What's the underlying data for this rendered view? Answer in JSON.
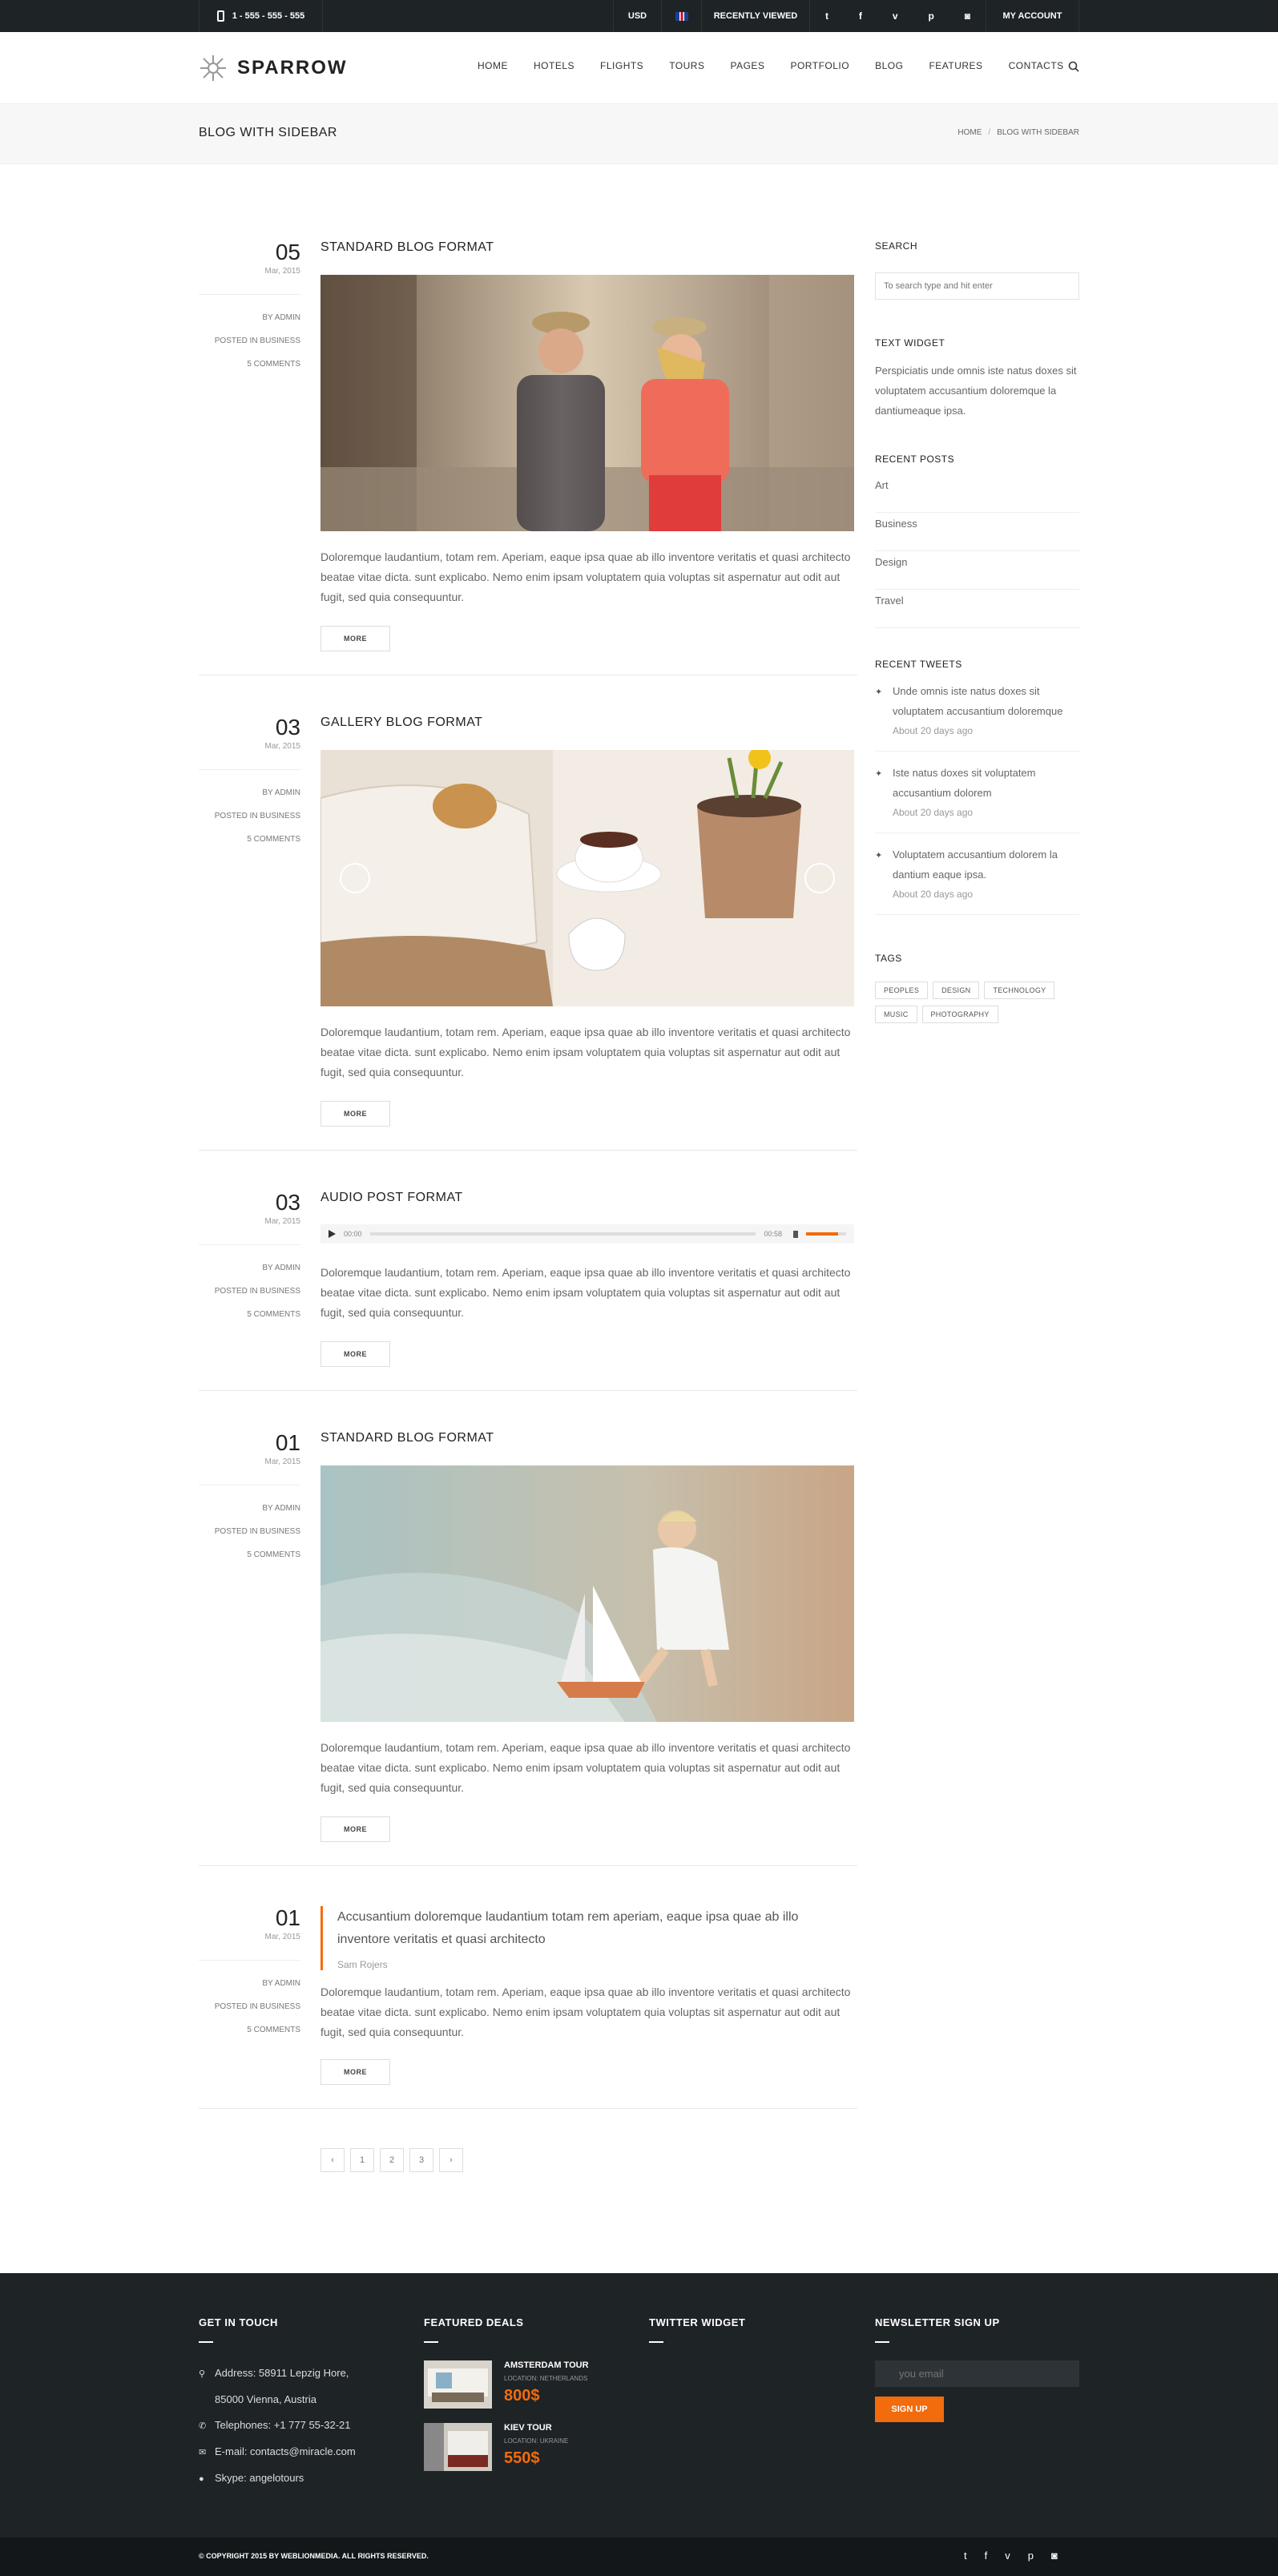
{
  "topbar": {
    "phone": "1 - 555 - 555 - 555",
    "currency": "USD",
    "recently_viewed": "RECENTLY VIEWED",
    "social": [
      "t",
      "f",
      "v",
      "p",
      "◙"
    ],
    "account": "MY ACCOUNT"
  },
  "header": {
    "logo": "SPARROW",
    "nav": [
      "HOME",
      "HOTELS",
      "FLIGHTS",
      "TOURS",
      "PAGES",
      "PORTFOLIO",
      "BLOG",
      "FEATURES",
      "CONTACTS"
    ]
  },
  "page": {
    "title": "BLOG WITH SIDEBAR",
    "breadcrumb": [
      "HOME",
      "/",
      "BLOG WITH SIDEBAR"
    ]
  },
  "posts": [
    {
      "day": "05",
      "month": "Mar, 2015",
      "author": "BY ADMIN",
      "category": "POSTED IN BUSINESS",
      "comments": "5 COMMENTS",
      "title": "STANDARD BLOG FORMAT",
      "excerpt": "Doloremque laudantium, totam rem. Aperiam, eaque ipsa quae ab illo inventore veritatis et quasi architecto beatae vitae dicta. sunt explicabo. Nemo enim ipsam voluptatem quia voluptas sit aspernatur aut odit aut fugit, sed quia consequuntur.",
      "more": "MORE"
    },
    {
      "day": "03",
      "month": "Mar, 2015",
      "author": "BY ADMIN",
      "category": "POSTED IN BUSINESS",
      "comments": "5 COMMENTS",
      "title": "GALLERY BLOG FORMAT",
      "excerpt": "Doloremque laudantium, totam rem. Aperiam, eaque ipsa quae ab illo inventore veritatis et quasi architecto beatae vitae dicta. sunt explicabo. Nemo enim ipsam voluptatem quia voluptas sit aspernatur aut odit aut fugit, sed quia consequuntur.",
      "more": "MORE"
    },
    {
      "day": "03",
      "month": "Mar, 2015",
      "author": "BY ADMIN",
      "category": "POSTED IN BUSINESS",
      "comments": "5 COMMENTS",
      "title": "AUDIO POST FORMAT",
      "excerpt": "Doloremque laudantium, totam rem. Aperiam, eaque ipsa quae ab illo inventore veritatis et quasi architecto beatae vitae dicta. sunt explicabo. Nemo enim ipsam voluptatem quia voluptas sit aspernatur aut odit aut fugit, sed quia consequuntur.",
      "more": "MORE",
      "audio": {
        "current": "00:00",
        "duration": "00:58",
        "volume": 0.8
      }
    },
    {
      "day": "01",
      "month": "Mar, 2015",
      "author": "BY ADMIN",
      "category": "POSTED IN BUSINESS",
      "comments": "5 COMMENTS",
      "title": "STANDARD BLOG FORMAT",
      "excerpt": "Doloremque laudantium, totam rem. Aperiam, eaque ipsa quae ab illo inventore veritatis et quasi architecto beatae vitae dicta. sunt explicabo. Nemo enim ipsam voluptatem quia voluptas sit aspernatur aut odit aut fugit, sed quia consequuntur.",
      "more": "MORE"
    },
    {
      "day": "01",
      "month": "Mar, 2015",
      "author": "BY ADMIN",
      "category": "POSTED IN BUSINESS",
      "comments": "5 COMMENTS",
      "quote": "Accusantium doloremque laudantium totam rem aperiam, eaque ipsa quae ab illo inventore veritatis et quasi architecto",
      "quote_author": "Sam Rojers",
      "excerpt": "Doloremque laudantium, totam rem. Aperiam, eaque ipsa quae ab illo inventore veritatis et quasi architecto beatae vitae dicta. sunt explicabo. Nemo enim ipsam voluptatem quia voluptas sit aspernatur aut odit aut fugit, sed quia consequuntur.",
      "more": "MORE"
    }
  ],
  "pagination": [
    "‹",
    "1",
    "2",
    "3",
    "›"
  ],
  "sidebar": {
    "search_title": "SEARCH",
    "search_placeholder": "To search type and hit enter",
    "text_widget_title": "TEXT WIDGET",
    "text_widget": "Perspiciatis unde omnis iste natus doxes sit voluptatem accusantium doloremque la dantiumeaque ipsa.",
    "recent_posts_title": "RECENT POSTS",
    "recent_posts": [
      "Art",
      "Business",
      "Design",
      "Travel"
    ],
    "recent_tweets_title": "RECENT TWEETS",
    "tweets": [
      {
        "text": "Unde omnis iste natus doxes sit voluptatem accusantium doloremque",
        "ago": "About 20 days ago"
      },
      {
        "text": "Iste natus doxes sit voluptatem accusantium dolorem",
        "ago": "About 20 days ago"
      },
      {
        "text": "Voluptatem accusantium dolorem la dantium eaque ipsa.",
        "ago": "About 20 days ago"
      }
    ],
    "tags_title": "TAGS",
    "tags": [
      "PEOPLES",
      "DESIGN",
      "TECHNOLOGY",
      "MUSIC",
      "PHOTOGRAPHY"
    ]
  },
  "footer": {
    "get_in_touch": "GET IN TOUCH",
    "address": "Address: 58911 Lepzig Hore,",
    "address2": "85000 Vienna, Austria",
    "telephone": "Telephones: +1 777 55-32-21",
    "email": "E-mail: contacts@miracle.com",
    "skype": "Skype: angelotours",
    "featured_title": "FEATURED DEALS",
    "deals": [
      {
        "name": "AMSTERDAM TOUR",
        "location": "LOCATION: NETHERLANDS",
        "price": "800$"
      },
      {
        "name": "KIEV TOUR",
        "location": "LOCATION: UKRAINE",
        "price": "550$"
      }
    ],
    "twitter_title": "TWITTER WIDGET",
    "newsletter_title": "NEWSLETTER SIGN UP",
    "newsletter_placeholder": "you email",
    "signup": "SIGN UP",
    "copyright": "© COPYRIGHT 2015 BY WEBLIONMEDIA. ALL RIGHTS RESERVED.",
    "social": [
      "t",
      "f",
      "v",
      "p",
      "◙"
    ]
  },
  "colors": {
    "accent": "#f26b0d",
    "dark": "#1e2326"
  }
}
